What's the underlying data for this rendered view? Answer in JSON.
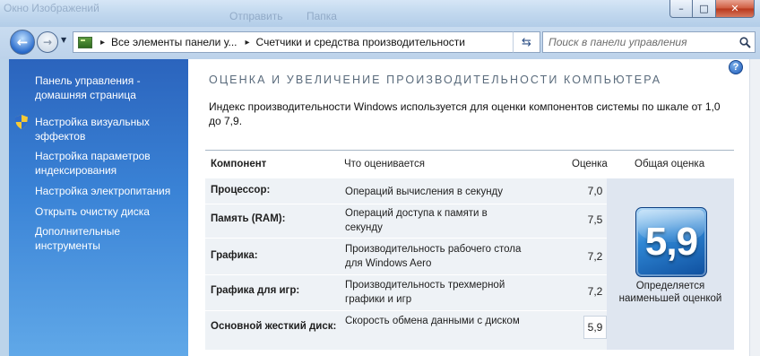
{
  "window": {
    "ghost_title_fragments": [
      "Окно Изображений",
      "Отправить",
      "Папка"
    ],
    "controls": {
      "minimize": "–",
      "maximize": "□",
      "close": "✕"
    }
  },
  "navigation": {
    "breadcrumbs": [
      "Все элементы панели у...",
      "Счетчики и средства производительности"
    ],
    "search_placeholder": "Поиск в панели управления"
  },
  "sidebar": {
    "items": [
      {
        "label": "Панель управления - домашняя страница",
        "icon": null
      },
      {
        "label": "Настройка визуальных эффектов",
        "icon": "shield-icon"
      },
      {
        "label": "Настройка параметров индексирования",
        "icon": null
      },
      {
        "label": "Настройка электропитания",
        "icon": null
      },
      {
        "label": "Открыть очистку диска",
        "icon": null
      },
      {
        "label": "Дополнительные инструменты",
        "icon": null
      }
    ]
  },
  "main": {
    "title": "ОЦЕНКА И УВЕЛИЧЕНИЕ ПРОИЗВОДИТЕЛЬНОСТИ КОМПЬЮТЕРА",
    "description": "Индекс производительности Windows используется для оценки компонентов системы по шкале от 1,0 до 7,9.",
    "table": {
      "headers": [
        "Компонент",
        "Что оценивается",
        "Оценка",
        "Общая оценка"
      ],
      "rows": [
        {
          "component": "Процессор:",
          "measures": "Операций вычисления в секунду",
          "score": "7,0"
        },
        {
          "component": "Память (RAM):",
          "measures": "Операций доступа к памяти в секунду",
          "score": "7,5"
        },
        {
          "component": "Графика:",
          "measures": "Производительность рабочего стола для Windows Aero",
          "score": "7,2"
        },
        {
          "component": "Графика для игр:",
          "measures": "Производительность трехмерной графики и игр",
          "score": "7,2"
        },
        {
          "component": "Основной жесткий диск:",
          "measures": "Скорость обмена данными с диском",
          "score": "5,9"
        }
      ],
      "lowest_row": "Основной жесткий диск:"
    },
    "base_score": {
      "value": "5,9",
      "caption": "Определяется наименьшей оценкой"
    }
  },
  "colors": {
    "sidebar_top": "#2b64bd",
    "sidebar_bottom": "#60a8e8",
    "tile": "#2e86d4"
  }
}
